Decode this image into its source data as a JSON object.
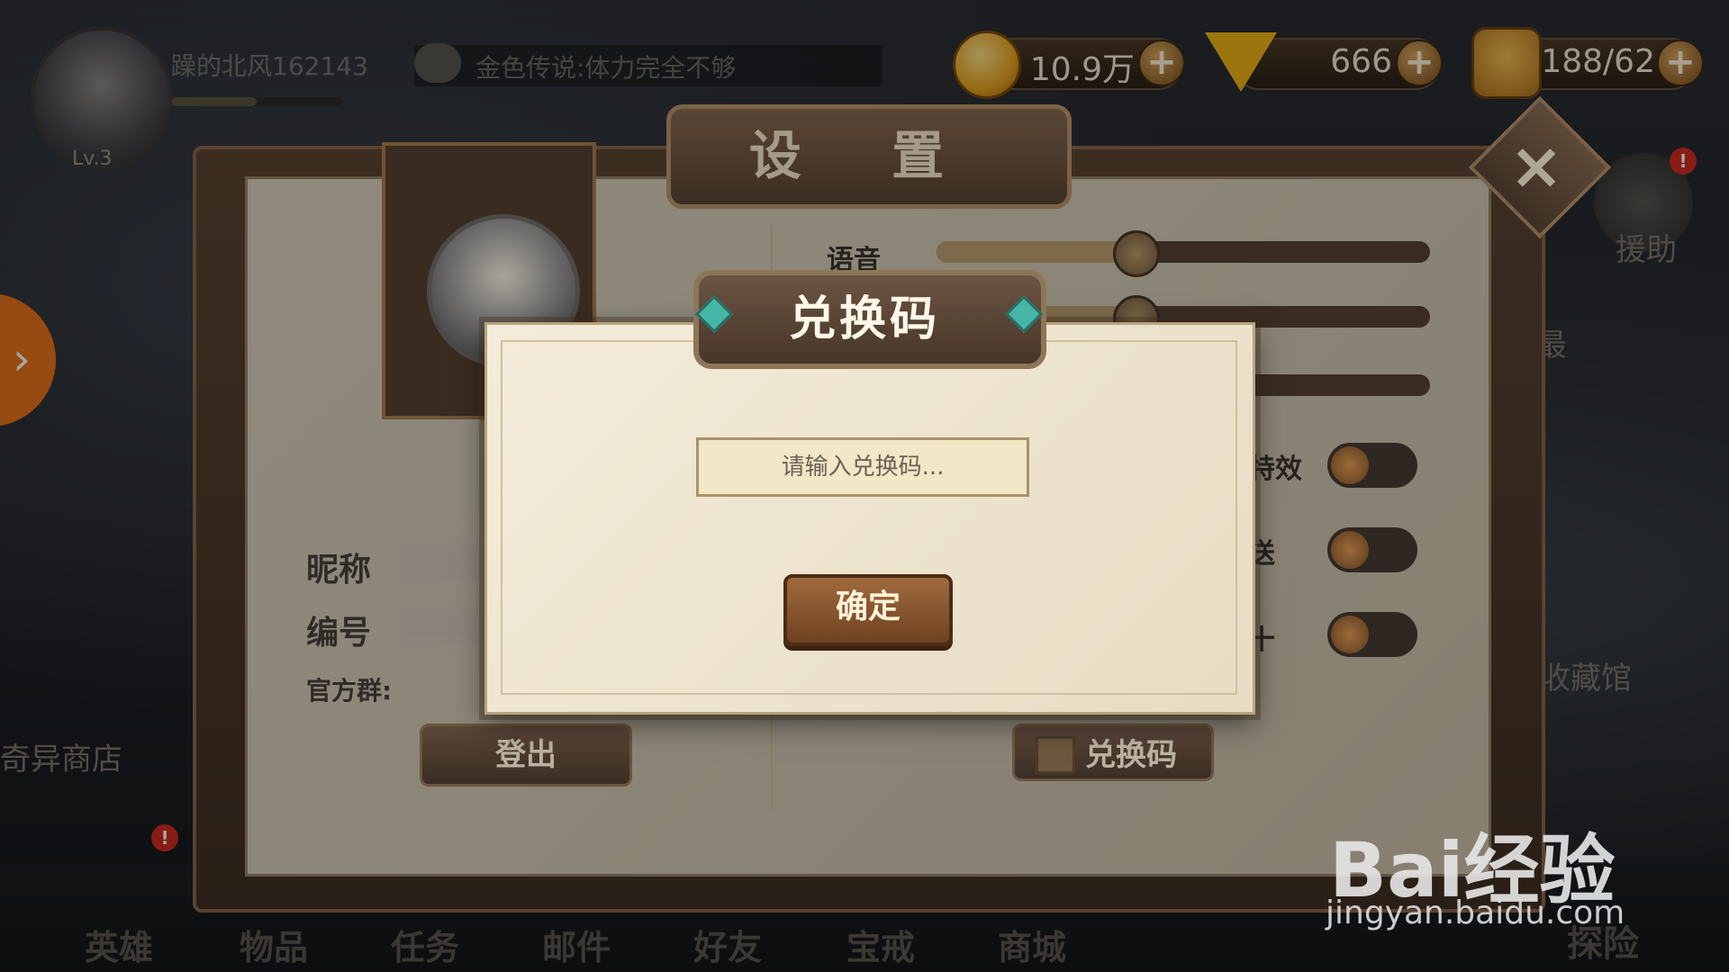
{
  "player": {
    "name": "躁的北风162143",
    "level": "Lv.3",
    "xp_progress": 0.5
  },
  "chat": {
    "message": "金色传说:体力完全不够"
  },
  "resources": {
    "gold": "10.9万",
    "diamonds": "666",
    "stamina": "188/62"
  },
  "background": {
    "left_shop": "奇异商店",
    "assist": "援助",
    "right_partial": "最",
    "collection": "收藏馆",
    "adventure": "探险",
    "nav": [
      "英雄",
      "物品",
      "任务",
      "邮件",
      "好友",
      "宝戒",
      "商城"
    ]
  },
  "settings": {
    "title": "设 置",
    "profile": {
      "nickname_label": "昵称",
      "id_label": "编号",
      "group_label": "官方群:"
    },
    "voice_label": "语音",
    "voice_level": 0.4,
    "music_level": 0.4,
    "toggle_labels": [
      "特效",
      "送",
      "十"
    ],
    "logout_button": "登出",
    "redeem_button": "兑换码"
  },
  "redeem_dialog": {
    "title": "兑换码",
    "input_placeholder": "请输入兑换码...",
    "input_value": "",
    "confirm_button": "确定"
  },
  "watermark": {
    "logo": "Bai经验",
    "url": "jingyan.baidu.com"
  }
}
